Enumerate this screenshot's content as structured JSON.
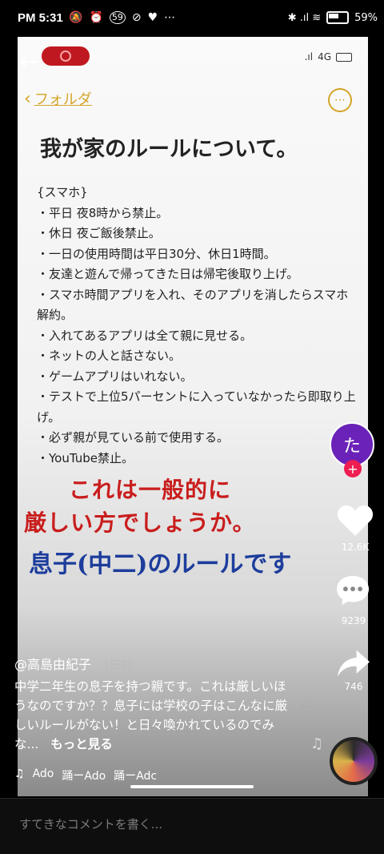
{
  "status_bar": {
    "time": "PM 5:31",
    "left_icons": [
      "🔕",
      "⏰",
      "59",
      "⊘",
      "♥",
      "⋯"
    ],
    "right_icons": "✱ .ıl ≋",
    "battery": "59%"
  },
  "video": {
    "inner_status": "4G",
    "folder_label": "フォルダ",
    "note_title": "我が家のルールについて。",
    "rules": [
      "{スマホ}",
      "・平日 夜8時から禁止。",
      "・休日 夜ご飯後禁止。",
      "・一日の使用時間は平日30分、休日1時間。",
      "・友達と遊んで帰ってきた日は帰宅後取り上げ。",
      "・スマホ時間アプリを入れ、そのアプリを消したらスマホ解約。",
      "・入れてあるアプリは全て親に見せる。",
      "・ネットの人と話さない。",
      "・ゲームアプリはいれない。",
      "・テストで上位5パーセントに入っていなかったら即取り上げ。",
      "・必ず親が見ている前で使用する。",
      "・YouTube禁止。"
    ],
    "overlay_line1": "これは一般的に",
    "overlay_line2": "厳しい方でしょうか。",
    "overlay_line3": "息子(中二)のルールです"
  },
  "sidebar": {
    "avatar_char": "た",
    "likes": "12.6K",
    "comments": "9239",
    "shares": "746"
  },
  "post": {
    "author": "@高島由紀子",
    "age": "· 1日前",
    "caption": "中学二年生の息子を持つ親です。これは厳しいほうなのですか？？息子には学校の子はこんなに厳しいルールがない！と日々喚かれているのでみな...",
    "more": "もっと見る",
    "music_items": [
      "Ado",
      "踊ーAdo",
      "踊ーAdc"
    ]
  },
  "comment_bar": {
    "placeholder": "すてきなコメントを書く..."
  },
  "colors": {
    "accent_red": "#ee1d52",
    "note_gold": "#d5a428",
    "overlay_red": "#c91d1d",
    "overlay_blue": "#1d3d9c"
  }
}
